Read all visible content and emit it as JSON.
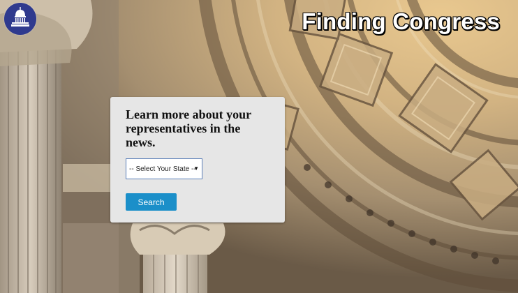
{
  "header": {
    "logo_icon": "capitol-dome-icon",
    "title": "Finding Congress"
  },
  "card": {
    "heading": "Learn more about your representatives in the news.",
    "state_select": {
      "selected": "-- Select Your State --"
    },
    "search_button": "Search"
  },
  "colors": {
    "logo_background": "#2f3a8e",
    "button_background": "#1b8fc9",
    "card_background": "#e6e6e6"
  }
}
